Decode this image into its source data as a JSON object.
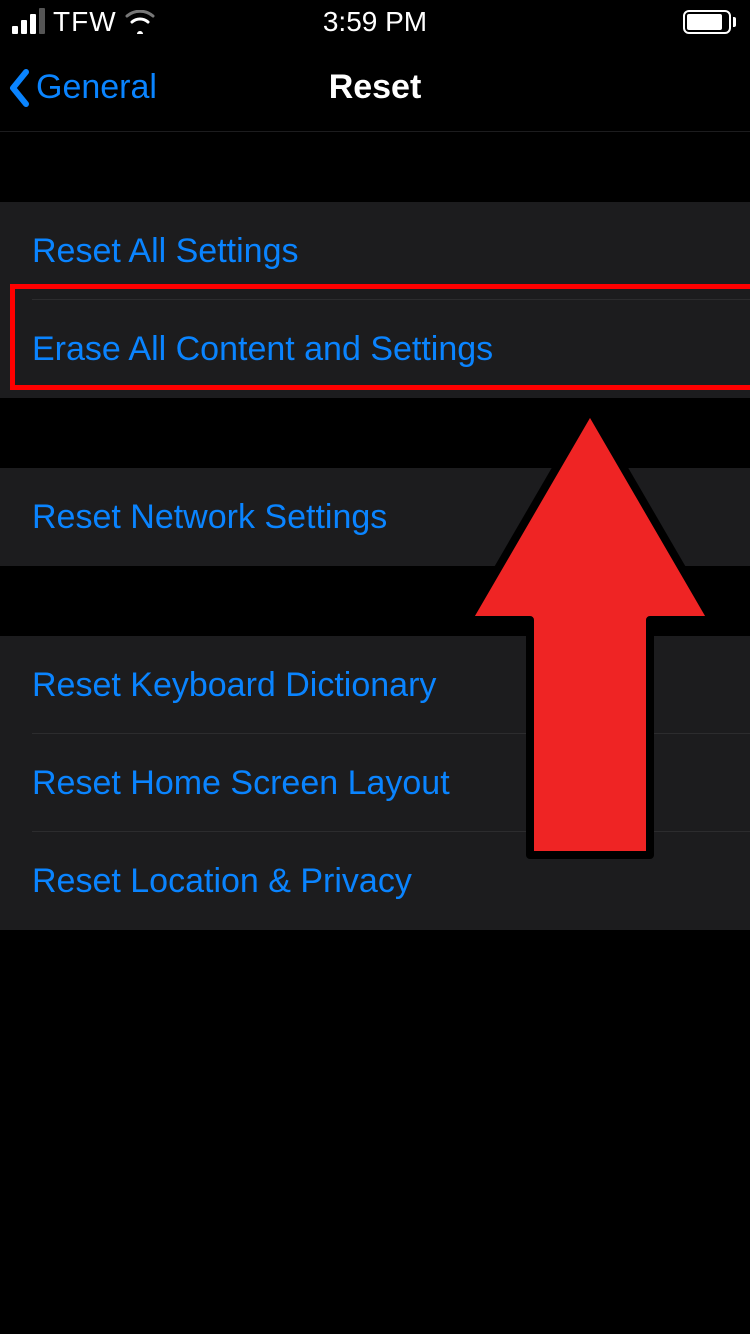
{
  "status_bar": {
    "carrier": "TFW",
    "time": "3:59 PM"
  },
  "nav": {
    "back_label": "General",
    "title": "Reset"
  },
  "groups": [
    {
      "items": [
        {
          "label": "Reset All Settings",
          "key": "reset-all-settings"
        },
        {
          "label": "Erase All Content and Settings",
          "key": "erase-all-content"
        }
      ]
    },
    {
      "items": [
        {
          "label": "Reset Network Settings",
          "key": "reset-network"
        }
      ]
    },
    {
      "items": [
        {
          "label": "Reset Keyboard Dictionary",
          "key": "reset-keyboard-dictionary"
        },
        {
          "label": "Reset Home Screen Layout",
          "key": "reset-home-screen"
        },
        {
          "label": "Reset Location & Privacy",
          "key": "reset-location-privacy"
        }
      ]
    }
  ],
  "annotation": {
    "highlight_target_key": "erase-all-content",
    "arrow_color": "#ef2424"
  }
}
